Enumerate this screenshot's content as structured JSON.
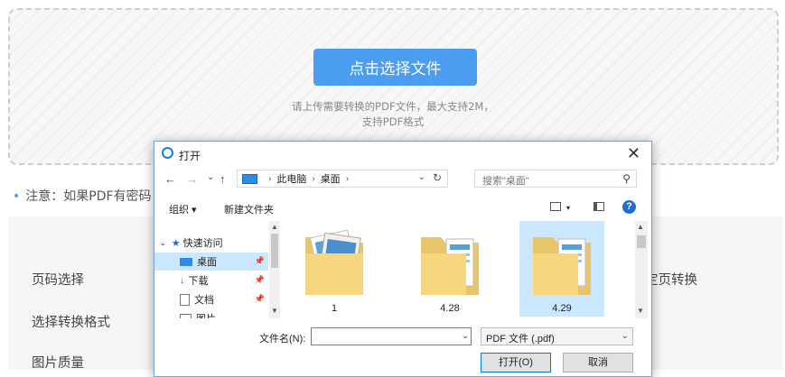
{
  "upload": {
    "button_label": "点击选择文件",
    "hint_line1": "请上传需要转换的PDF文件，最大支持2M，",
    "hint_line2": "支持PDF格式"
  },
  "note": {
    "text": "注意：如果PDF有密码"
  },
  "settings": {
    "page_select_label": "页码选择",
    "format_label": "选择转换格式",
    "quality_label": "图片质量",
    "right_label": "定页转换"
  },
  "dialog": {
    "title": "打开",
    "close": "✕",
    "nav": {
      "back": "←",
      "forward": "→",
      "recent": "⌄",
      "up": "↑"
    },
    "breadcrumb": [
      "此电脑",
      "桌面"
    ],
    "search_placeholder": "搜索\"桌面\"",
    "toolbar": {
      "organize": "组织 ▾",
      "new_folder": "新建文件夹",
      "help": "?"
    },
    "nav_pane": {
      "quick_access": "快速访问",
      "items": [
        "桌面",
        "下载",
        "文档",
        "图片"
      ]
    },
    "files": [
      {
        "name": "1",
        "icon": "folder-icon"
      },
      {
        "name": "4.28",
        "icon": "folder-icon"
      },
      {
        "name": "4.29",
        "icon": "folder-icon",
        "selected": true
      }
    ],
    "filename_label": "文件名(N):",
    "filename_value": "",
    "filetype": "PDF 文件 (.pdf)",
    "open_button": "打开(O)",
    "cancel_button": "取消"
  }
}
